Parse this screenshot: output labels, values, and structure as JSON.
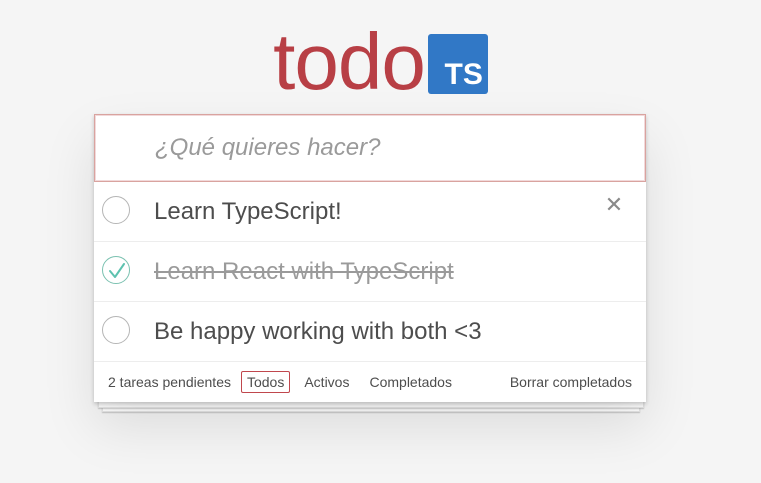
{
  "header": {
    "logo_text": "todo",
    "badge_text": "TS"
  },
  "new_todo": {
    "placeholder": "¿Qué quieres hacer?",
    "value": ""
  },
  "todos": [
    {
      "label": "Learn TypeScript!",
      "completed": false
    },
    {
      "label": "Learn React with TypeScript",
      "completed": true
    },
    {
      "label": "Be happy working with both <3",
      "completed": false
    }
  ],
  "footer": {
    "count_text": "2 tareas pendientes",
    "filters": [
      {
        "label": "Todos",
        "selected": true
      },
      {
        "label": "Activos",
        "selected": false
      },
      {
        "label": "Completados",
        "selected": false
      }
    ],
    "clear_label": "Borrar completados"
  },
  "icons": {
    "destroy": "close-icon",
    "check": "check-icon"
  },
  "colors": {
    "brand": "#b83f45",
    "ts_badge": "#3178c6",
    "check": "#5dc2af"
  }
}
